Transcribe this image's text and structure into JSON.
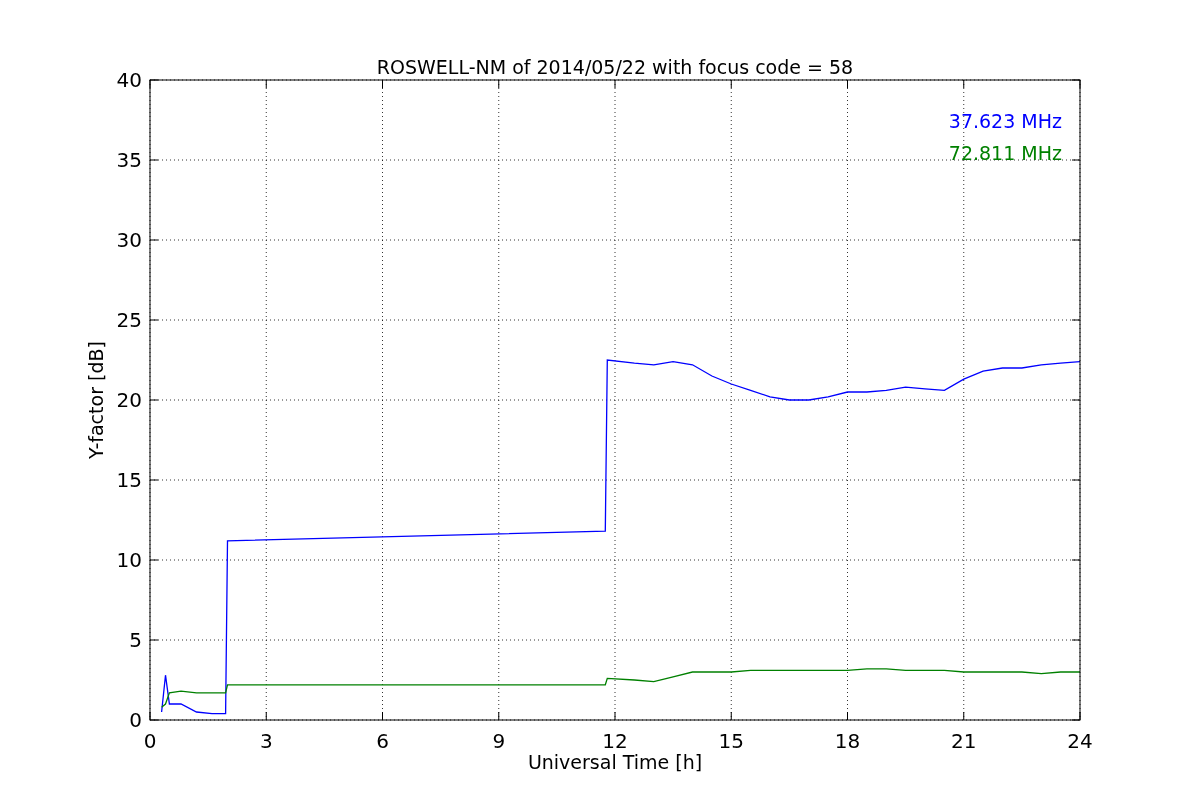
{
  "chart_data": {
    "type": "line",
    "title": "ROSWELL-NM of 2014/05/22 with focus code = 58",
    "xlabel": "Universal Time [h]",
    "ylabel": "Y-factor [dB]",
    "x": [
      0.3,
      0.4,
      0.5,
      0.8,
      1.2,
      1.6,
      1.95,
      2.0,
      11.75,
      11.8,
      12.5,
      13,
      13.5,
      14,
      14.5,
      15,
      15.5,
      16,
      16.5,
      17,
      17.5,
      18,
      18.5,
      19,
      19.5,
      20,
      20.5,
      21,
      21.5,
      22,
      22.5,
      23,
      23.5,
      24
    ],
    "series": [
      {
        "name": "37.623 MHz",
        "color": "#0000ff",
        "values": [
          0.5,
          2.8,
          1.0,
          1.0,
          0.5,
          0.4,
          0.4,
          11.2,
          11.8,
          22.5,
          22.3,
          22.2,
          22.4,
          22.2,
          21.5,
          21.0,
          20.6,
          20.2,
          20.0,
          20.0,
          20.2,
          20.5,
          20.5,
          20.6,
          20.8,
          20.7,
          20.6,
          21.3,
          21.8,
          22.0,
          22.0,
          22.2,
          22.3,
          22.4
        ]
      },
      {
        "name": "72.811 MHz",
        "color": "#008000",
        "values": [
          0.8,
          1.0,
          1.7,
          1.8,
          1.7,
          1.7,
          1.7,
          2.2,
          2.2,
          2.6,
          2.5,
          2.4,
          2.7,
          3.0,
          3.0,
          3.0,
          3.1,
          3.1,
          3.1,
          3.1,
          3.1,
          3.1,
          3.2,
          3.2,
          3.1,
          3.1,
          3.1,
          3.0,
          3.0,
          3.0,
          3.0,
          2.9,
          3.0,
          3.0
        ]
      }
    ],
    "xlim": [
      0,
      24
    ],
    "ylim": [
      0,
      40
    ],
    "xticks": [
      0,
      3,
      6,
      9,
      12,
      15,
      18,
      21,
      24
    ],
    "yticks": [
      0,
      5,
      10,
      15,
      20,
      25,
      30,
      35,
      40
    ],
    "grid": true
  }
}
